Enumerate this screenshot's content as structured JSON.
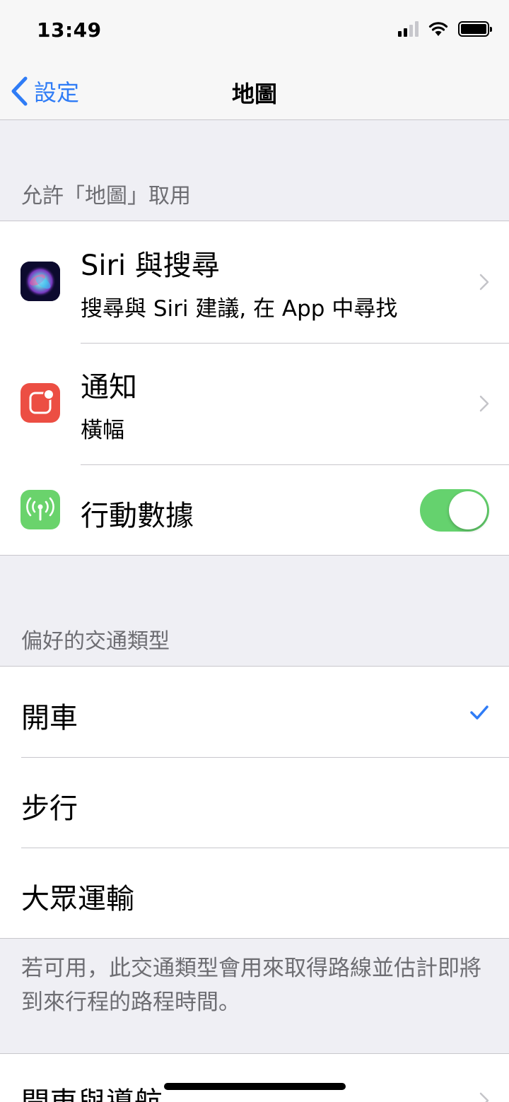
{
  "status_bar": {
    "time": "13:49"
  },
  "nav": {
    "back_label": "設定",
    "title": "地圖"
  },
  "section_access": {
    "header": "允許「地圖」取用",
    "rows": [
      {
        "title": "Siri 與搜尋",
        "subtitle": "搜尋與 Siri 建議, 在 App 中尋找",
        "icon": "siri-icon"
      },
      {
        "title": "通知",
        "subtitle": "橫幅",
        "icon": "notifications-icon"
      },
      {
        "title": "行動數據",
        "icon": "cellular-data-icon",
        "toggle_on": true
      }
    ]
  },
  "section_transport": {
    "header": "偏好的交通類型",
    "options": [
      "開車",
      "步行",
      "大眾運輸"
    ],
    "selected": "開車",
    "footer": "若可用，此交通類型會用來取得路線並估計即將到來行程的路程時間。"
  },
  "section_next": {
    "row_title": "開車與導航"
  },
  "colors": {
    "accent": "#2f7cf6",
    "toggle_on": "#65d26e",
    "notifications_icon": "#ec4e43",
    "cellular_icon": "#6ad36c"
  }
}
